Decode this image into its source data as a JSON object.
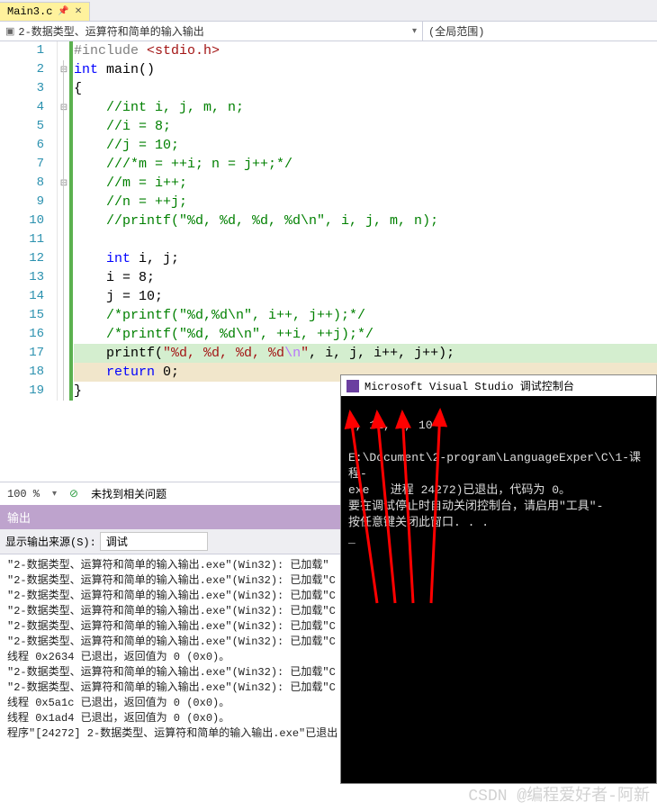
{
  "tab": {
    "name": "Main3.c"
  },
  "nav": {
    "left": "2-数据类型、运算符和简单的输入输出",
    "right": "(全局范围)"
  },
  "code": {
    "lines": [
      {
        "pre": "#include ",
        "inc": "<stdio.h>"
      },
      {
        "kw": "int",
        "post": " main()"
      },
      {
        "text": "{"
      },
      {
        "cm": "    //int i, j, m, n;"
      },
      {
        "cm": "    //i = 8;"
      },
      {
        "cm": "    //j = 10;"
      },
      {
        "cm": "    ///*m = ++i; n = j++;*/"
      },
      {
        "cm": "    //m = i++;"
      },
      {
        "cm": "    //n = ++j;"
      },
      {
        "cm": "    //printf(\"%d, %d, %d, %d\\n\", i, j, m, n);"
      },
      {
        "text": " "
      },
      {
        "kw": "    int",
        "post": " i, j;"
      },
      {
        "text": "    i = 8;"
      },
      {
        "text": "    j = 10;"
      },
      {
        "cm": "    /*printf(\"%d,%d\\n\", i++, j++);*/"
      },
      {
        "cm": "    /*printf(\"%d, %d\\n\", ++i, ++j);*/"
      },
      {
        "pre": "    printf(",
        "str": "\"%d, %d, %d, %d",
        "esc": "\\n",
        "str2": "\"",
        "post": ", i, j, i++, j++);"
      },
      {
        "kw": "    return",
        "post": " 0;"
      },
      {
        "text": "}"
      }
    ]
  },
  "status": {
    "zoom": "100 %",
    "msg": "未找到相关问题"
  },
  "output": {
    "title": "输出",
    "srcLabel": "显示输出来源(S):",
    "srcValue": "调试",
    "lines": [
      "\"2-数据类型、运算符和简单的输入输出.exe\"(Win32): 已加载\"",
      "\"2-数据类型、运算符和简单的输入输出.exe\"(Win32): 已加载\"C",
      "\"2-数据类型、运算符和简单的输入输出.exe\"(Win32): 已加载\"C",
      "\"2-数据类型、运算符和简单的输入输出.exe\"(Win32): 已加载\"C",
      "\"2-数据类型、运算符和简单的输入输出.exe\"(Win32): 已加载\"C",
      "\"2-数据类型、运算符和简单的输入输出.exe\"(Win32): 已加载\"C",
      "线程 0x2634 已退出，返回值为 0 (0x0)。",
      "\"2-数据类型、运算符和简单的输入输出.exe\"(Win32): 已加载\"C",
      "\"2-数据类型、运算符和简单的输入输出.exe\"(Win32): 已加载\"C",
      "线程 0x5a1c 已退出，返回值为 0 (0x0)。",
      "线程 0x1ad4 已退出，返回值为 0 (0x0)。",
      "程序\"[24272] 2-数据类型、运算符和简单的输入输出.exe\"已退出"
    ]
  },
  "console": {
    "title": "Microsoft Visual Studio 调试控制台",
    "out": "9, 11, 8, 10",
    "line2": "E:\\Document\\2-program\\LanguageExper\\C\\1-课程-",
    "line3": "exe   进程 24272)已退出，代码为 0。",
    "line4": "要在调试停止时自动关闭控制台，请启用\"工具\"-",
    "line5": "按任意键关闭此窗口. . ."
  },
  "watermark": "CSDN @编程爱好者-阿新"
}
